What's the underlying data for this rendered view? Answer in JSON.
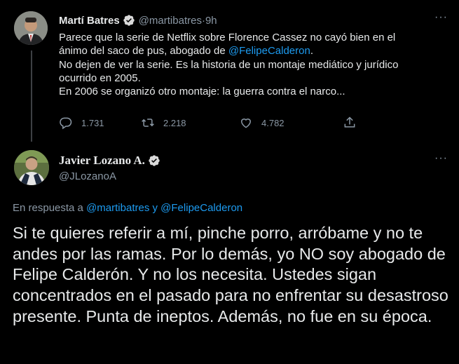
{
  "tweet1": {
    "name": "Martí Batres",
    "handle": "@martibatres",
    "separator": " · ",
    "time": "9h",
    "text_lines": {
      "l1": "Parece que la serie de Netflix sobre Florence Cassez no cayó bien en el",
      "l2_prefix": "ánimo del saco de pus, abogado de ",
      "l2_link": "@FelipeCalderon",
      "l2_suffix": ".",
      "l3": "No dejen de ver la serie. Es la historia de un montaje mediático y jurídico",
      "l4": "ocurrido en 2005.",
      "l5": "En 2006 se organizó otro montaje: la guerra contra el narco..."
    },
    "replies": "1.731",
    "retweets": "2.218",
    "likes": "4.782"
  },
  "tweet2": {
    "name": "Javier Lozano A.",
    "handle": "@JLozanoA",
    "reply_to_prefix": "En respuesta a ",
    "reply_to_user1": "@martibatres",
    "reply_to_and": " y ",
    "reply_to_user2": "@FelipeCalderon",
    "text": "Si te quieres referir a mí, pinche porro, arróbame y no te andes por las ramas. Por lo demás, yo NO soy abogado de Felipe Calderón. Y no los necesita. Ustedes sigan concentrados en el pasado para no enfrentar su desastroso presente. Punta de ineptos. Además, no fue en su época."
  },
  "more_label": "···",
  "icons": {
    "verified": "verified-badge-icon",
    "reply": "reply-icon",
    "retweet": "retweet-icon",
    "like": "heart-icon",
    "share": "share-icon",
    "more": "more-dots-icon"
  },
  "colors": {
    "background": "#000000",
    "link": "#1d9bf0",
    "secondary_text": "#8b98a5",
    "primary_text": "#e7e9ea",
    "verified": "#1d9bf0"
  }
}
